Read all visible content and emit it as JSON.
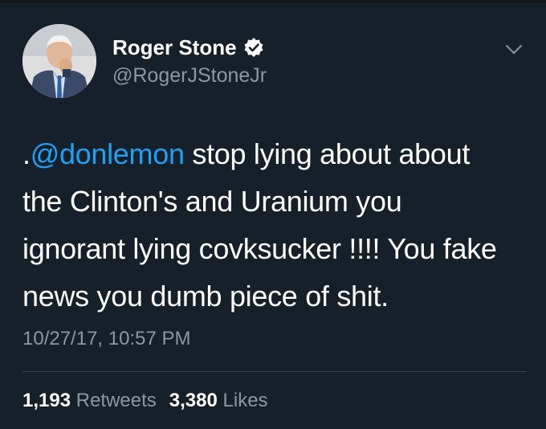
{
  "author": {
    "display_name": "Roger Stone",
    "handle": "@RogerJStoneJr",
    "avatar_icon": "avatar-photo",
    "verified_icon": "verified-badge-icon"
  },
  "menu_icon": "chevron-down-icon",
  "tweet": {
    "line1_prefix": ".",
    "line1_mention": "@donlemon",
    "line1_rest": " stop lying about about",
    "line2": "the Clinton's and Uranium you",
    "line3": "ignorant lying covksucker !!!! You fake",
    "line4": "news you dumb piece of shit."
  },
  "timestamp": "10/27/17, 10:57 PM",
  "stats": {
    "retweets_count": "1,193",
    "retweets_label": "Retweets",
    "likes_count": "3,380",
    "likes_label": "Likes"
  },
  "colors": {
    "background": "#15202b",
    "text": "#ffffff",
    "secondary": "#8899a6",
    "link": "#1da1f2",
    "divider": "#38444d"
  }
}
